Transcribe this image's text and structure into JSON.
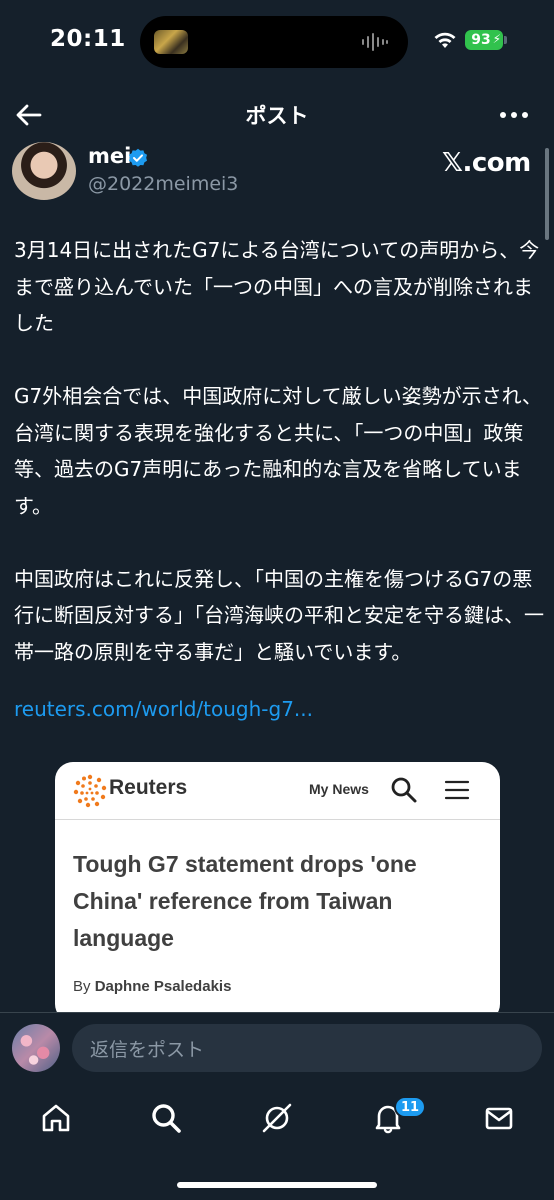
{
  "status_bar": {
    "time": "20:11",
    "battery": "93"
  },
  "header": {
    "title": "ポスト"
  },
  "author": {
    "name": "mei",
    "handle": "@2022meimei3",
    "source": "𝕏.com"
  },
  "post": {
    "text": "3月14日に出されたG7による台湾についての声明から、今まで盛り込んでいた「一つの中国」への言及が削除されました\n\nG7外相会合では、中国政府に対して厳しい姿勢が示され、台湾に関する表現を強化すると共に、「一つの中国」政策等、過去のG7声明にあった融和的な言及を省略しています。\n\n中国政府はこれに反発し、「中国の主権を傷つけるG7の悪行に断固反対する」「台湾海峡の平和と安定を守る鍵は、一帯一路の原則を守る事だ」と騒いでいます。",
    "link": "reuters.com/world/tough-g7..."
  },
  "card": {
    "brand": "Reuters",
    "my_news": "My News",
    "headline": "Tough G7 statement drops 'one China' reference from Taiwan language",
    "byline_prefix": "By",
    "byline_author": "Daphne Psaledakis"
  },
  "reply": {
    "placeholder": "返信をポスト"
  },
  "nav": {
    "notification_count": "11"
  },
  "colors": {
    "background": "#15202b",
    "accent": "#1d9bf0",
    "muted": "#8b98a5"
  }
}
